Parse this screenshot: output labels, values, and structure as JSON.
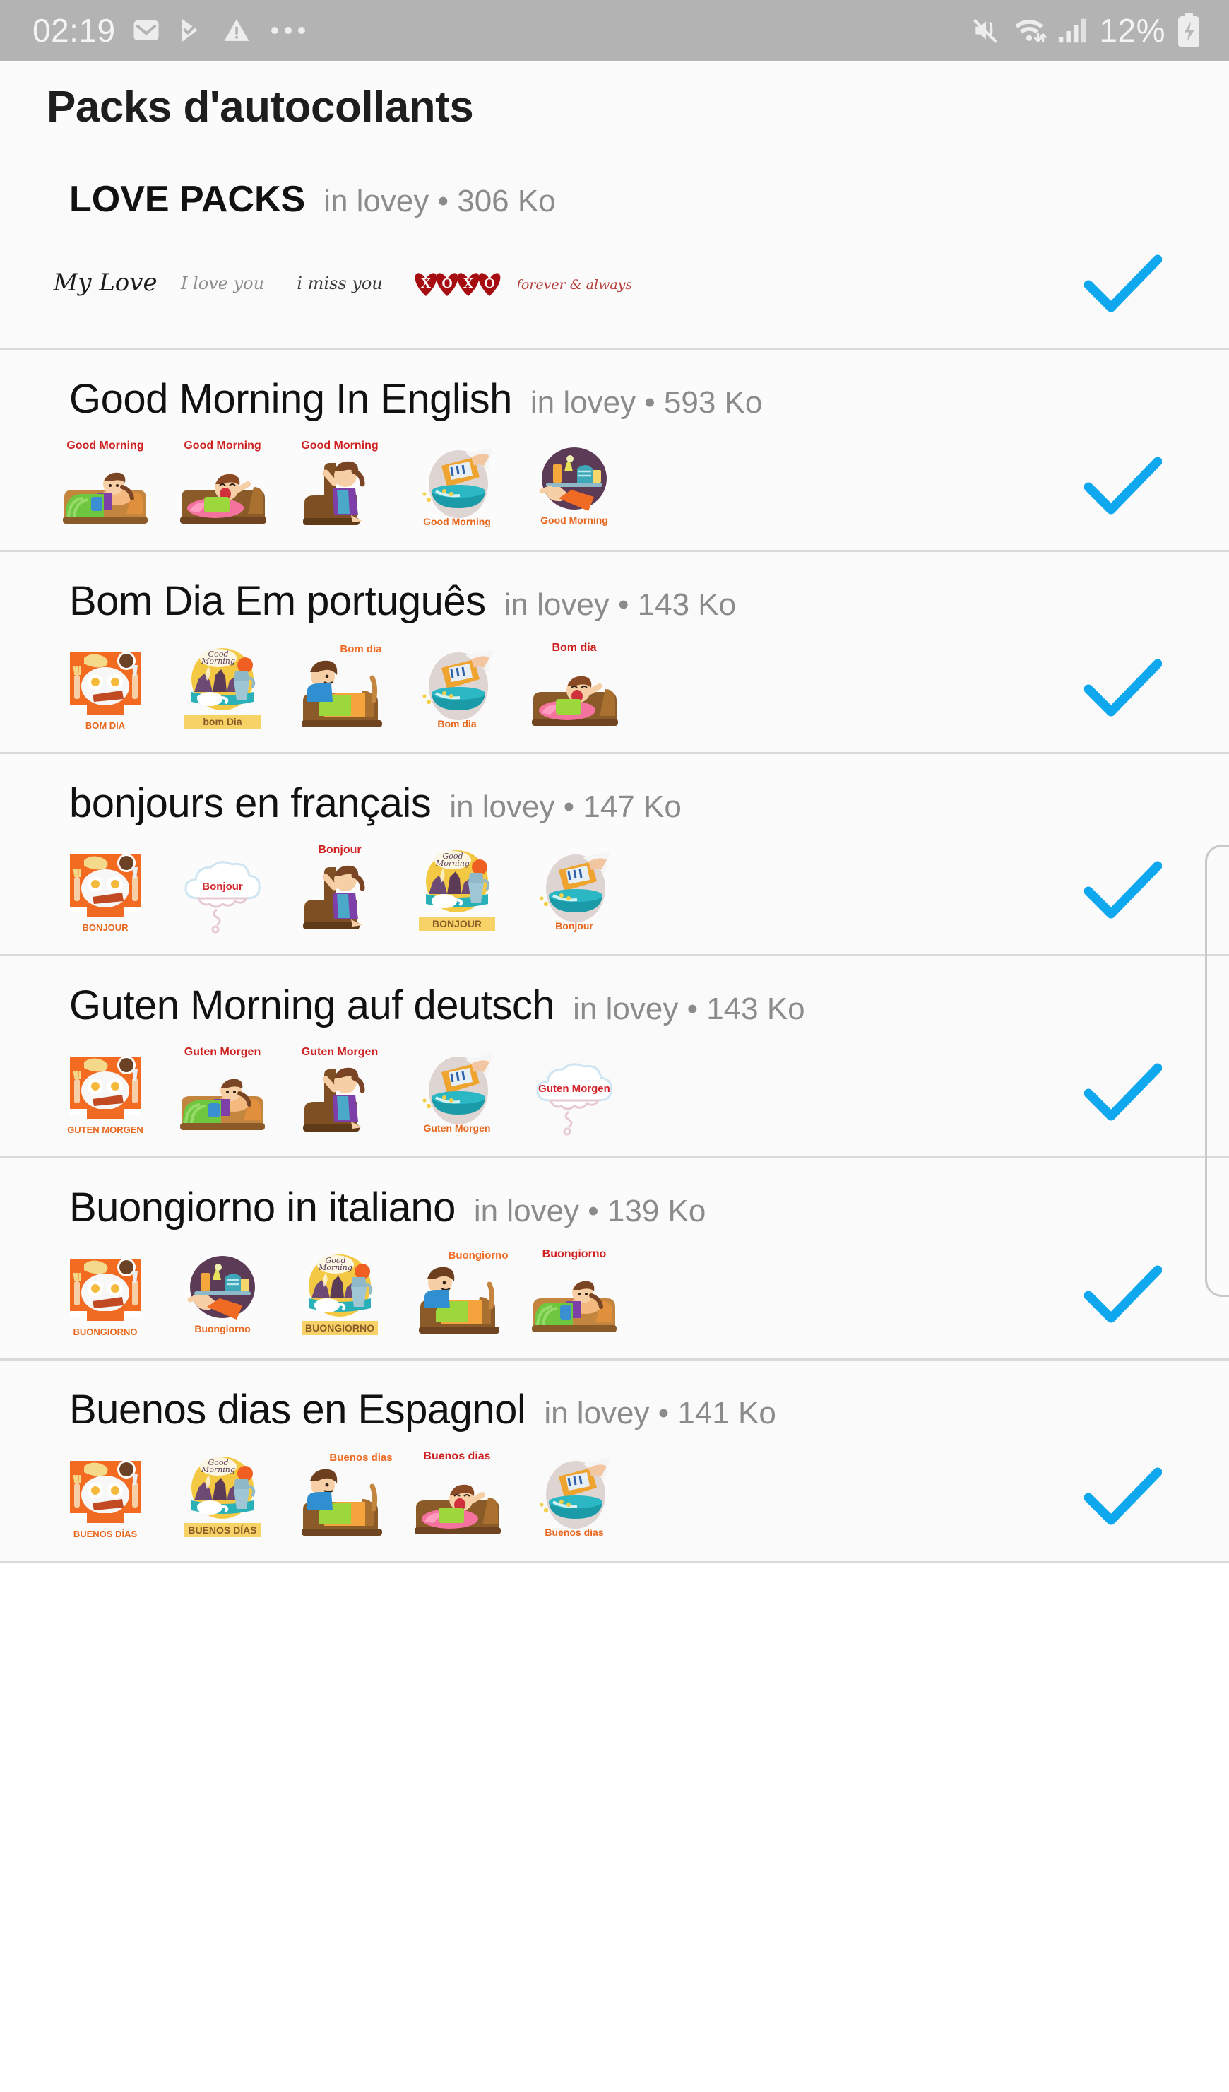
{
  "status_bar": {
    "time": "02:19",
    "battery_percent": "12%",
    "icons": [
      "mail-icon",
      "play-store-icon",
      "warning-icon",
      "more-dots-icon",
      "mute-vibrate-icon",
      "wifi-icon",
      "signal-icon",
      "battery-charging-icon"
    ]
  },
  "header": {
    "title": "Packs d'autocollants"
  },
  "colors": {
    "check_blue": "#0fa8ee",
    "separator": "#dadada",
    "background": "#fafafa",
    "status_bar": "#b3b3b3",
    "meta_text": "#8b8b8b",
    "title_text": "#111111"
  },
  "packs": [
    {
      "name": "LOVE PACKS",
      "meta": "in lovey • 306 Ko",
      "publisher": "in lovey",
      "size": "306 Ko",
      "selected": true,
      "check_label": "check-icon",
      "stickers": [
        {
          "name": "sticker-my-love",
          "text": "My Love",
          "style": "script-black"
        },
        {
          "name": "sticker-i-love-you",
          "text": "I love you",
          "style": "script-gray"
        },
        {
          "name": "sticker-i-miss-you",
          "text": "i miss you",
          "style": "italic-dark"
        },
        {
          "name": "sticker-xoxo",
          "text": "XOXO",
          "style": "hearts-red"
        },
        {
          "name": "sticker-forever-always",
          "text": "forever & always",
          "style": "script-red"
        }
      ]
    },
    {
      "name": "Good Morning In English",
      "meta": "in lovey • 593 Ko",
      "publisher": "in lovey",
      "size": "593 Ko",
      "selected": true,
      "check_label": "check-icon",
      "stickers": [
        {
          "name": "sticker-girl-in-bed",
          "text": "Good Morning",
          "style": "bed-girl-green"
        },
        {
          "name": "sticker-boy-yawning",
          "text": "Good Morning",
          "style": "bed-yawn-pink"
        },
        {
          "name": "sticker-person-sitting",
          "text": "Good Morning",
          "style": "sitting-bed"
        },
        {
          "name": "sticker-cereal-bowl",
          "text": "Good Morning",
          "style": "cereal"
        },
        {
          "name": "sticker-breakfast-tray",
          "text": "Good Morning",
          "style": "tray"
        }
      ]
    },
    {
      "name": "Bom Dia Em português",
      "meta": "in lovey • 143 Ko",
      "publisher": "in lovey",
      "size": "143 Ko",
      "selected": true,
      "check_label": "check-icon",
      "stickers": [
        {
          "name": "sticker-breakfast-plate",
          "text": "BOM DIA",
          "style": "plate"
        },
        {
          "name": "sticker-coffee-city",
          "text": "bom Dia",
          "style": "coffee-city"
        },
        {
          "name": "sticker-boy-in-bed",
          "text": "Bom dia",
          "style": "bed-boy-blue"
        },
        {
          "name": "sticker-cereal-bowl",
          "text": "Bom dia",
          "style": "cereal"
        },
        {
          "name": "sticker-boy-yawning",
          "text": "Bom dia",
          "style": "bed-yawn-pink"
        }
      ]
    },
    {
      "name": "bonjours en français",
      "meta": "in lovey • 147 Ko",
      "publisher": "in lovey",
      "size": "147 Ko",
      "selected": true,
      "check_label": "check-icon",
      "stickers": [
        {
          "name": "sticker-breakfast-plate",
          "text": "BONJOUR",
          "style": "plate"
        },
        {
          "name": "sticker-speech-cloud",
          "text": "Bonjour",
          "style": "cloud"
        },
        {
          "name": "sticker-person-sitting",
          "text": "Bonjour",
          "style": "sitting-bed"
        },
        {
          "name": "sticker-coffee-city",
          "text": "BONJOUR",
          "style": "coffee-city"
        },
        {
          "name": "sticker-cereal-bowl",
          "text": "Bonjour",
          "style": "cereal"
        }
      ]
    },
    {
      "name": "Guten Morning auf deutsch",
      "meta": "in lovey • 143 Ko",
      "publisher": "in lovey",
      "size": "143 Ko",
      "selected": true,
      "check_label": "check-icon",
      "stickers": [
        {
          "name": "sticker-breakfast-plate",
          "text": "GUTEN MORGEN",
          "style": "plate"
        },
        {
          "name": "sticker-girl-in-bed",
          "text": "Guten Morgen",
          "style": "bed-girl-green"
        },
        {
          "name": "sticker-person-sitting",
          "text": "Guten Morgen",
          "style": "sitting-bed"
        },
        {
          "name": "sticker-cereal-bowl",
          "text": "Guten Morgen",
          "style": "cereal"
        },
        {
          "name": "sticker-speech-cloud",
          "text": "Guten Morgen",
          "style": "cloud"
        }
      ]
    },
    {
      "name": "Buongiorno in italiano",
      "meta": "in lovey • 139 Ko",
      "publisher": "in lovey",
      "size": "139 Ko",
      "selected": true,
      "check_label": "check-icon",
      "stickers": [
        {
          "name": "sticker-breakfast-plate",
          "text": "BUONGIORNO",
          "style": "plate"
        },
        {
          "name": "sticker-breakfast-tray",
          "text": "Buongiorno",
          "style": "tray"
        },
        {
          "name": "sticker-coffee-city",
          "text": "BUONGIORNO",
          "style": "coffee-city"
        },
        {
          "name": "sticker-boy-in-bed",
          "text": "Buongiorno",
          "style": "bed-boy-blue"
        },
        {
          "name": "sticker-girl-in-bed",
          "text": "Buongiorno",
          "style": "bed-girl-green"
        }
      ]
    },
    {
      "name": "Buenos dias en Espagnol",
      "meta": "in lovey • 141 Ko",
      "publisher": "in lovey",
      "size": "141 Ko",
      "selected": true,
      "check_label": "check-icon",
      "stickers": [
        {
          "name": "sticker-breakfast-plate",
          "text": "BUENOS DÍAS",
          "style": "plate"
        },
        {
          "name": "sticker-coffee-city",
          "text": "BUENOS DÍAS",
          "style": "coffee-city"
        },
        {
          "name": "sticker-boy-in-bed",
          "text": "Buenos dias",
          "style": "bed-boy-blue"
        },
        {
          "name": "sticker-boy-yawning",
          "text": "Buenos dias",
          "style": "bed-yawn-pink"
        },
        {
          "name": "sticker-cereal-bowl",
          "text": "Buenos dias",
          "style": "cereal"
        }
      ]
    }
  ]
}
